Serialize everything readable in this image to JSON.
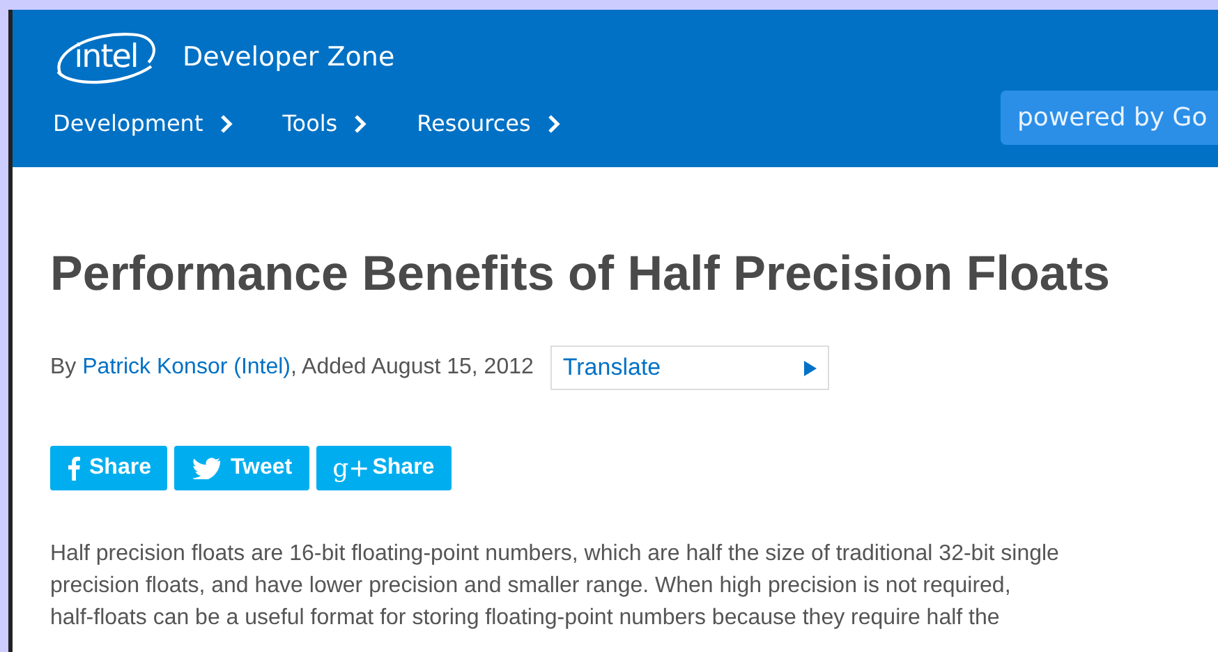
{
  "header": {
    "logo": "intel",
    "site_title": "Developer Zone",
    "nav": [
      {
        "label": "Development"
      },
      {
        "label": "Tools"
      },
      {
        "label": "Resources"
      }
    ],
    "search_badge": "powered by Go"
  },
  "article": {
    "title": "Performance Benefits of Half Precision Floats",
    "byline": {
      "prefix": "By ",
      "author": "Patrick Konsor (Intel)",
      "suffix": ", Added August 15, 2012"
    },
    "translate": "Translate",
    "share": [
      {
        "kind": "facebook",
        "label": "Share"
      },
      {
        "kind": "twitter",
        "label": "Tweet"
      },
      {
        "kind": "googleplus",
        "glyph": "g+",
        "label": "Share"
      }
    ],
    "paragraph_lines": [
      "Half precision floats are 16-bit floating-point numbers, which are half the size of traditional 32-bit single",
      "precision floats, and have lower precision and smaller range. When high precision is not required,",
      "half-floats can be a useful format for storing floating-point numbers because they require half the"
    ]
  }
}
